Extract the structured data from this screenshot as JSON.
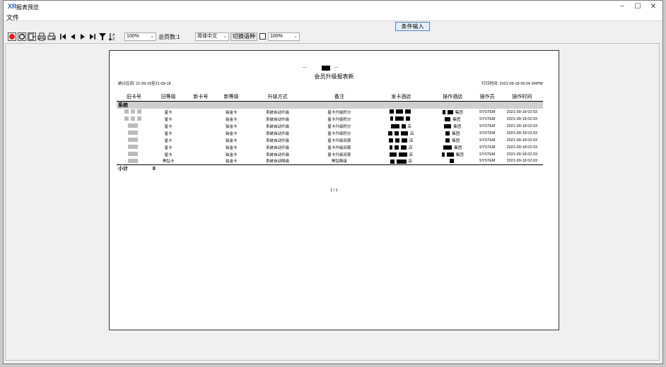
{
  "window": {
    "title": "报表预览",
    "icon": "xr-logo-icon",
    "controls": {
      "minimize": "−",
      "maximize": "☐",
      "close": "✕"
    }
  },
  "menu": {
    "file": "文件"
  },
  "condition_button": "条件输入",
  "toolbar": {
    "zoom1": "100%",
    "total_pages": "总页数:1",
    "language": "简体中文",
    "switch_language": "切换语种",
    "zoom2": "100%"
  },
  "report": {
    "title": "会员升级报表新",
    "stat_range": "统计区间:   21-09-18至21-09-18",
    "print_time": "打印时间: 2021-09-18 09:24 XRPW",
    "columns": [
      "旧卡号",
      "旧等级",
      "新卡号",
      "新等级",
      "升级方式",
      "备注",
      "发卡酒店",
      "操作酒店",
      "操作员",
      "操作时间"
    ],
    "group_label": "系统",
    "rows": [
      {
        "old_level": "星卡",
        "new_level": "铂金卡",
        "method": "系统自动升级",
        "remark": "星卡升级积分",
        "hotel_suffix": "",
        "op_hotel_suffix": "集团",
        "operator": "SYSTEM",
        "time": "2021-09-18 02:03"
      },
      {
        "old_level": "星卡",
        "new_level": "铂金卡",
        "method": "系统自动升级",
        "remark": "星卡升级积分",
        "hotel_suffix": "",
        "op_hotel_suffix": "集团",
        "operator": "SYSTEM",
        "time": "2021-09-18 02:03"
      },
      {
        "old_level": "星卡",
        "new_level": "铂金卡",
        "method": "系统自动升级",
        "remark": "星卡升级积分",
        "hotel_suffix": "店",
        "op_hotel_suffix": "集团",
        "operator": "SYSTEM",
        "time": "2021-09-18 02:03"
      },
      {
        "old_level": "星卡",
        "new_level": "铂金卡",
        "method": "系统自动升级",
        "remark": "星卡升级积分",
        "hotel_suffix": "店",
        "op_hotel_suffix": "集团",
        "operator": "SYSTEM",
        "time": "2021-09-18 02:03"
      },
      {
        "old_level": "星卡",
        "new_level": "铂金卡",
        "method": "系统自动升级",
        "remark": "星卡升级间夜",
        "hotel_suffix": "店",
        "op_hotel_suffix": "集团",
        "operator": "SYSTEM",
        "time": "2021-09-18 02:03"
      },
      {
        "old_level": "星卡",
        "new_level": "铂金卡",
        "method": "系统自动升级",
        "remark": "星卡升级间夜",
        "hotel_suffix": "店",
        "op_hotel_suffix": "集团",
        "operator": "SYSTEM",
        "time": "2021-09-18 02:03"
      },
      {
        "old_level": "星卡",
        "new_level": "铂金卡",
        "method": "系统自动升级",
        "remark": "星卡升级间夜",
        "hotel_suffix": "店",
        "op_hotel_suffix": "集团",
        "operator": "SYSTEM",
        "time": "2021-09-18 02:03"
      },
      {
        "old_level": "黑钻卡",
        "new_level": "铂金卡",
        "method": "系统自动降级",
        "remark": "黑钻降级",
        "hotel_suffix": "店",
        "op_hotel_suffix": "",
        "operator": "SYSTEM",
        "time": "2021-09-18 02:03"
      }
    ],
    "subtotal_label": "小计",
    "subtotal_value": "8",
    "page_indicator": "1 / 1"
  }
}
